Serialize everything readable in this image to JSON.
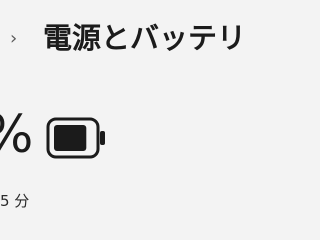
{
  "header": {
    "breadcrumb_chevron": "›",
    "title": "電源とバッテリ"
  },
  "battery": {
    "percent_suffix": "%",
    "time_remaining": "5 分",
    "charge_level": 0.85
  },
  "icons": {
    "breadcrumb": "chevron-right-icon",
    "battery": "battery-icon"
  }
}
